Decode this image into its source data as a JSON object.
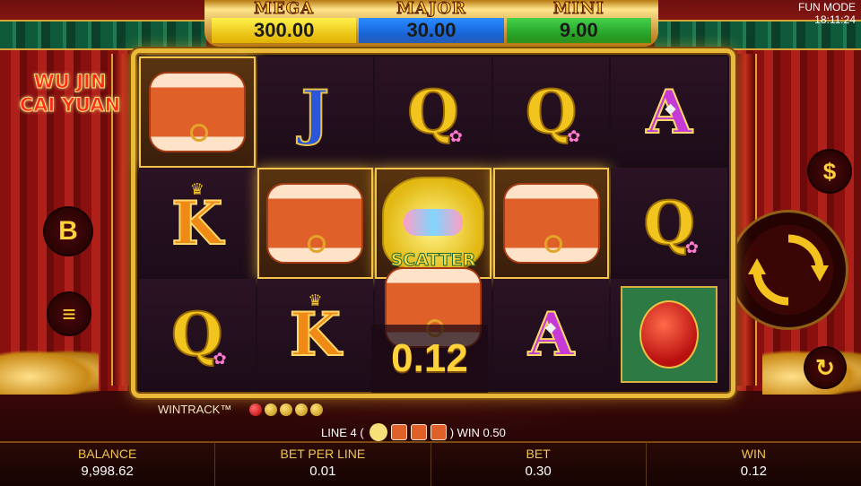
{
  "jackpots": {
    "mega_label": "MEGA",
    "mega_value": "300.00",
    "major_label": "MAJOR",
    "major_value": "30.00",
    "mini_label": "MINI",
    "mini_value": "9.00"
  },
  "status": {
    "mode": "FUN MODE",
    "time": "18:11:24"
  },
  "title": {
    "line1": "WU JIN",
    "line2": "CAI YUAN"
  },
  "buttons": {
    "buy": "B",
    "menu": "≡",
    "currency": "$",
    "spin": "↻",
    "auto": "↻"
  },
  "reels": [
    [
      "drum",
      "K",
      "Q"
    ],
    [
      "J",
      "drum",
      "K"
    ],
    [
      "Q",
      "scatter",
      "drum"
    ],
    [
      "Q",
      "drum",
      "A"
    ],
    [
      "A",
      "Q",
      "lantern"
    ]
  ],
  "scatter_label": "SCATTER",
  "win_popup": "0.12",
  "wintrack": {
    "label": "WINTRACK™"
  },
  "line_info": {
    "prefix": "LINE 4 (",
    "suffix": ") WIN 0.50"
  },
  "stats": {
    "balance_label": "BALANCE",
    "balance": "9,998.62",
    "bet_per_line_label": "BET PER LINE",
    "bet_per_line": "0.01",
    "bet_label": "BET",
    "bet": "0.30",
    "win_label": "WIN",
    "win": "0.12"
  },
  "colors": {
    "gold": "#f1c64a",
    "mega": "#f2d21a",
    "major": "#1f6fe0",
    "mini": "#2cb52e",
    "frame": "#e8b93a"
  }
}
